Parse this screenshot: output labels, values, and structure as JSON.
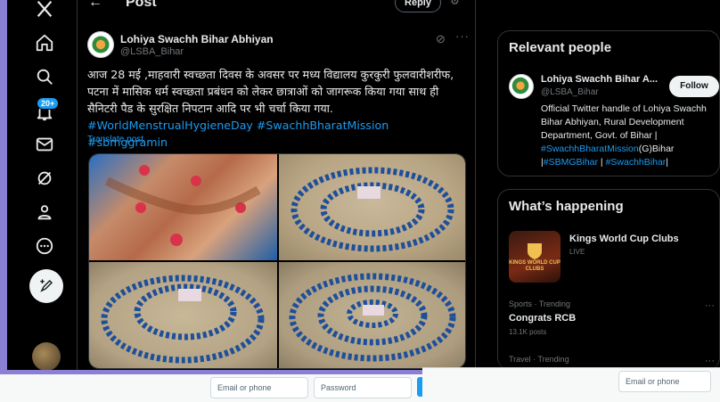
{
  "header": {
    "title": "Post",
    "back_icon": "arrow-left-icon",
    "reply_label": "Reply"
  },
  "nav": {
    "items": [
      "x-logo-icon",
      "home-icon",
      "search-icon",
      "notifications-icon",
      "messages-icon",
      "grok-icon",
      "profile-icon",
      "more-circle-icon"
    ],
    "notification_count": "20+",
    "post_icon": "compose-post-icon"
  },
  "tweet": {
    "name": "Lohiya Swachh Bihar Abhiyan",
    "handle": "@LSBA_Bihar",
    "text": "आज 28 मई ,माहवारी स्वच्छता दिवस के अवसर पर मध्य विद्यालय कुरकुरी फुलवारीशरीफ, पटना में मासिक धर्म स्वच्छता प्रबंधन को लेकर छात्राओं को जागरूक किया गया साथ ही सैनिटरी पैड के सुरक्षित निपटान आदि पर भी चर्चा किया गया.",
    "hashtags": "#WorldMenstrualHygieneDay #SwachhBharatMission #sbmggramin",
    "translate_label": "Translate post"
  },
  "relevant_people": {
    "title": "Relevant people",
    "name": "Lohiya Swachh Bihar A...",
    "handle": "@LSBA_Bihar",
    "follow_label": "Follow",
    "bio_text": "Official Twitter handle of Lohiya Swachh Bihar Abhiyan, Rural Development Department, Govt. of Bihar | ",
    "bio_tag1": "#SwachhBharatMission",
    "bio_mid": "(G)Bihar |",
    "bio_tag2": "#SBMGBihar",
    "bio_sep": " | ",
    "bio_tag3": "#SwachhBihar",
    "bio_end": "|"
  },
  "whats_happening": {
    "title": "What’s happening",
    "event_name": "Kings World Cup Clubs",
    "event_status": "LIVE",
    "thumb_text": "KINGS WORLD CUP CLUBS",
    "trends": [
      {
        "meta": "Sports · Trending",
        "name": "Congrats RCB",
        "count": "13.1K posts"
      },
      {
        "meta": "Travel · Trending",
        "name": "",
        "count": ""
      }
    ]
  },
  "login_bar": {
    "email_placeholder": "Email or phone",
    "password_placeholder": "Password",
    "email_placeholder_right": "Email or phone"
  },
  "colors": {
    "accent": "#1d9bf0",
    "frame": "#8b7fd4"
  }
}
